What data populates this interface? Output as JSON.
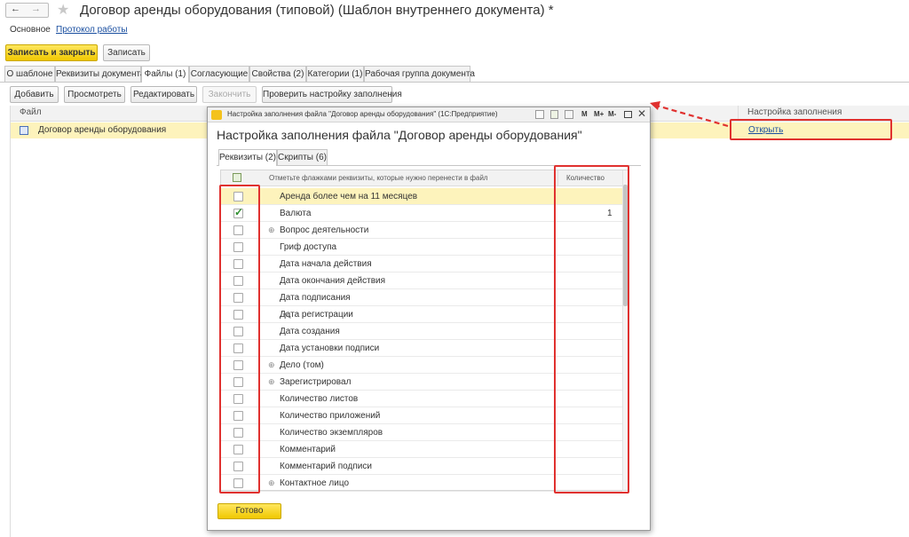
{
  "window": {
    "title": "Договор аренды оборудования (типовой) (Шаблон внутреннего документа) *"
  },
  "nav": {
    "back": "←",
    "forward": "→",
    "star": "★"
  },
  "subnav": {
    "main": "Основное",
    "log": "Протокол работы"
  },
  "toolbar": {
    "save_close": "Записать и закрыть",
    "save": "Записать"
  },
  "tabs": [
    "О шаблоне",
    "Реквизиты документа",
    "Файлы (1)",
    "Согласующие",
    "Свойства (2)",
    "Категории (1)",
    "Рабочая группа документа"
  ],
  "files_toolbar": {
    "add": "Добавить",
    "view": "Просмотреть",
    "edit": "Редактировать",
    "finish": "Закончить",
    "check": "Проверить настройку заполнения"
  },
  "files_table": {
    "col_file": "Файл",
    "col_settings": "Настройка заполнения",
    "row_file": "Договор аренды оборудования",
    "row_link": "Открыть"
  },
  "dialog": {
    "window_title": "Настройка заполнения файла \"Договор аренды оборудования\"  (1С:Предприятие)",
    "title_icons": [
      "M",
      "M+",
      "M-"
    ],
    "heading": "Настройка заполнения файла \"Договор аренды оборудования\"",
    "tabs": [
      "Реквизиты (2)",
      "Скрипты (6)"
    ],
    "col_check_hint": "Отметьте флажками реквизиты, которые нужно перенести в файл",
    "col_qty": "Количество",
    "rows": [
      {
        "label": "Аренда более чем на 11 месяцев",
        "checked": false,
        "expand": false,
        "qty": ""
      },
      {
        "label": "Валюта",
        "checked": true,
        "expand": false,
        "qty": "1"
      },
      {
        "label": "Вопрос деятельности",
        "checked": false,
        "expand": true,
        "qty": ""
      },
      {
        "label": "Гриф доступа",
        "checked": false,
        "expand": false,
        "qty": ""
      },
      {
        "label": "Дата начала действия",
        "checked": false,
        "expand": false,
        "qty": ""
      },
      {
        "label": "Дата окончания действия",
        "checked": false,
        "expand": false,
        "qty": ""
      },
      {
        "label": "Дата подписания",
        "checked": false,
        "expand": false,
        "qty": ""
      },
      {
        "label": "Дата регистрации",
        "checked": false,
        "expand": false,
        "qty": ""
      },
      {
        "label": "Дата создания",
        "checked": false,
        "expand": false,
        "qty": ""
      },
      {
        "label": "Дата установки подписи",
        "checked": false,
        "expand": false,
        "qty": ""
      },
      {
        "label": "Дело (том)",
        "checked": false,
        "expand": true,
        "qty": ""
      },
      {
        "label": "Зарегистрировал",
        "checked": false,
        "expand": true,
        "qty": ""
      },
      {
        "label": "Количество листов",
        "checked": false,
        "expand": false,
        "qty": ""
      },
      {
        "label": "Количество приложений",
        "checked": false,
        "expand": false,
        "qty": ""
      },
      {
        "label": "Количество экземпляров",
        "checked": false,
        "expand": false,
        "qty": ""
      },
      {
        "label": "Комментарий",
        "checked": false,
        "expand": false,
        "qty": ""
      },
      {
        "label": "Комментарий подписи",
        "checked": false,
        "expand": false,
        "qty": ""
      },
      {
        "label": "Контактное лицо",
        "checked": false,
        "expand": true,
        "qty": ""
      }
    ],
    "done": "Готово"
  },
  "colors": {
    "accent_yellow": "#f5d11c",
    "highlight_red": "#e0312f",
    "link": "#1a4fa0"
  }
}
